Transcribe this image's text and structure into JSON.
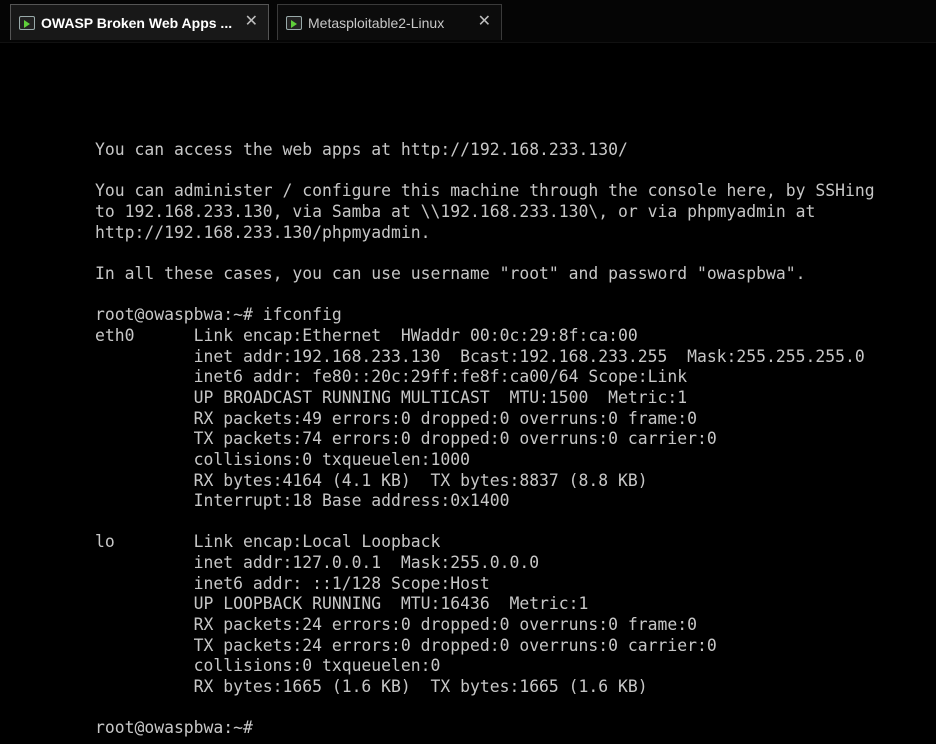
{
  "tabs": [
    {
      "label": "OWASP Broken Web Apps ...",
      "active": true,
      "icon": "vm-play-icon",
      "close": "✕"
    },
    {
      "label": "Metasploitable2-Linux",
      "active": false,
      "icon": "vm-play-icon",
      "close": "✕"
    }
  ],
  "terminal": {
    "lines": [
      "You can access the web apps at http://192.168.233.130/",
      "",
      "You can administer / configure this machine through the console here, by SSHing",
      "to 192.168.233.130, via Samba at \\\\192.168.233.130\\, or via phpmyadmin at",
      "http://192.168.233.130/phpmyadmin.",
      "",
      "In all these cases, you can use username \"root\" and password \"owaspbwa\".",
      "",
      "root@owaspbwa:~# ifconfig",
      "eth0      Link encap:Ethernet  HWaddr 00:0c:29:8f:ca:00",
      "          inet addr:192.168.233.130  Bcast:192.168.233.255  Mask:255.255.255.0",
      "          inet6 addr: fe80::20c:29ff:fe8f:ca00/64 Scope:Link",
      "          UP BROADCAST RUNNING MULTICAST  MTU:1500  Metric:1",
      "          RX packets:49 errors:0 dropped:0 overruns:0 frame:0",
      "          TX packets:74 errors:0 dropped:0 overruns:0 carrier:0",
      "          collisions:0 txqueuelen:1000",
      "          RX bytes:4164 (4.1 KB)  TX bytes:8837 (8.8 KB)",
      "          Interrupt:18 Base address:0x1400",
      "",
      "lo        Link encap:Local Loopback",
      "          inet addr:127.0.0.1  Mask:255.0.0.0",
      "          inet6 addr: ::1/128 Scope:Host",
      "          UP LOOPBACK RUNNING  MTU:16436  Metric:1",
      "          RX packets:24 errors:0 dropped:0 overruns:0 frame:0",
      "          TX packets:24 errors:0 dropped:0 overruns:0 carrier:0",
      "          collisions:0 txqueuelen:0",
      "          RX bytes:1665 (1.6 KB)  TX bytes:1665 (1.6 KB)",
      "",
      "root@owaspbwa:~#"
    ]
  },
  "colors": {
    "terminal_bg": "#000000",
    "terminal_fg": "#c7c7c7",
    "vm_play_icon": "#5fcf3a"
  }
}
